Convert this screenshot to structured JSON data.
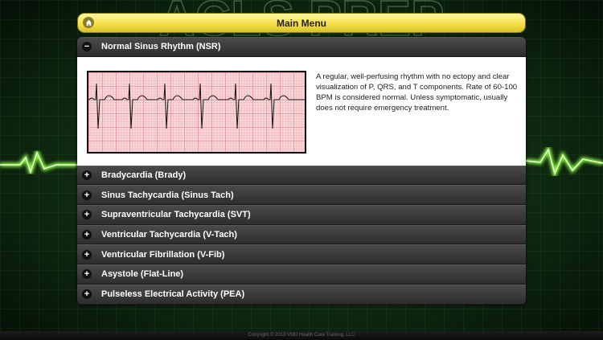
{
  "background": {
    "watermark": "ACLS PREP",
    "accent": "#7dff3a"
  },
  "menu": {
    "title": "Main Menu",
    "home_icon": "home-icon",
    "color": "#f4e04a"
  },
  "accordion": {
    "expanded": {
      "title": "Normal Sinus Rhythm (NSR)",
      "toggle": "−",
      "description": "A regular, well-perfusing rhythm with no ectopy and clear visualization of P, QRS, and T components. Rate of 60-100 BPM is considered normal. Unless symptomatic, usually does not require emergency treatment."
    },
    "collapsed": [
      {
        "title": "Bradycardia (Brady)",
        "toggle": "+"
      },
      {
        "title": "Sinus Tachycardia (Sinus Tach)",
        "toggle": "+"
      },
      {
        "title": "Supraventricular Tachycardia (SVT)",
        "toggle": "+"
      },
      {
        "title": "Ventricular Tachycardia (V-Tach)",
        "toggle": "+"
      },
      {
        "title": "Ventricular Fibrillation (V-Fib)",
        "toggle": "+"
      },
      {
        "title": "Asystole (Flat-Line)",
        "toggle": "+"
      },
      {
        "title": "Pulseless Electrical Activity (PEA)",
        "toggle": "+"
      }
    ]
  },
  "footer": {
    "copyright": "Copyright © 2013 VMD Health Care Training, LLC"
  }
}
